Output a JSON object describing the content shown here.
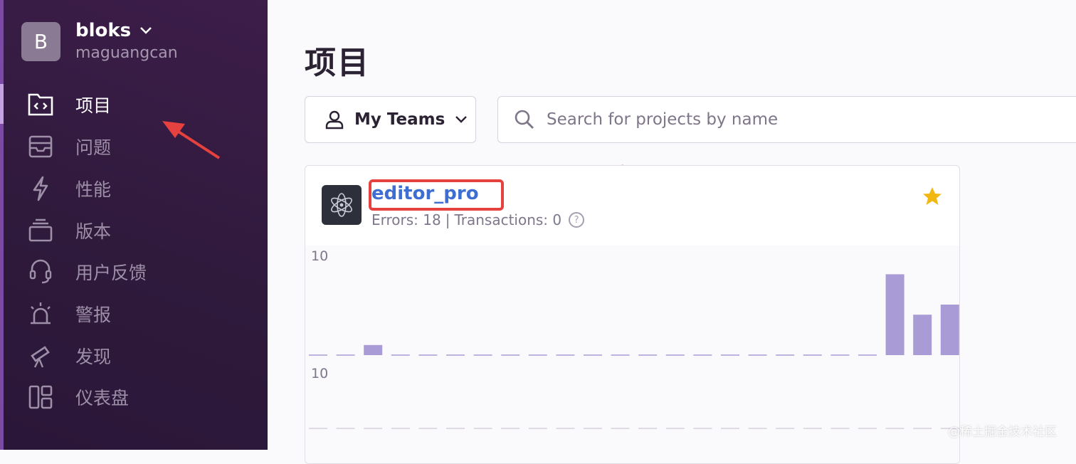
{
  "sidebar": {
    "org_initial": "B",
    "org_name": "bloks",
    "user_name": "maguangcan",
    "items": [
      {
        "label": "项目",
        "icon": "project-folder-icon",
        "active": true
      },
      {
        "label": "问题",
        "icon": "issues-inbox-icon",
        "active": false
      },
      {
        "label": "性能",
        "icon": "performance-lightning-icon",
        "active": false
      },
      {
        "label": "版本",
        "icon": "releases-stack-icon",
        "active": false
      },
      {
        "label": "用户反馈",
        "icon": "user-feedback-icon",
        "active": false
      },
      {
        "label": "警报",
        "icon": "alerts-siren-icon",
        "active": false
      },
      {
        "label": "发现",
        "icon": "discover-telescope-icon",
        "active": false
      },
      {
        "label": "仪表盘",
        "icon": "dashboards-grid-icon",
        "active": false
      }
    ]
  },
  "main": {
    "title": "项目",
    "teams_label": "My Teams",
    "search_placeholder": "Search for projects by name"
  },
  "project_card": {
    "name": "editor_pro",
    "errors_label": "Errors: 18",
    "separator": "|",
    "transactions_label": "Transactions: 0",
    "help_glyph": "?",
    "starred": true,
    "chart_label_top": "10",
    "chart_label_bottom": "10"
  },
  "chart_data": {
    "type": "bar",
    "title": "",
    "ylim": [
      0,
      10
    ],
    "values": [
      0,
      0,
      1,
      0,
      0,
      0,
      0,
      0,
      0,
      0,
      0,
      0,
      0,
      0,
      0,
      0,
      0,
      0,
      0,
      0,
      0,
      8,
      4,
      5
    ],
    "bottom_values": [
      0,
      0,
      0,
      0,
      0,
      0,
      0,
      0,
      0,
      0,
      0,
      0,
      0,
      0,
      0,
      0,
      0,
      0,
      0,
      0,
      0,
      0,
      0,
      0
    ]
  },
  "colors": {
    "sidebar_bg": "#2f1a3c",
    "link": "#3e6ed1",
    "bar": "#a99bd6",
    "star": "#f2b711",
    "annotation": "#e5413e"
  },
  "watermark": "@稀土掘金技术社区"
}
